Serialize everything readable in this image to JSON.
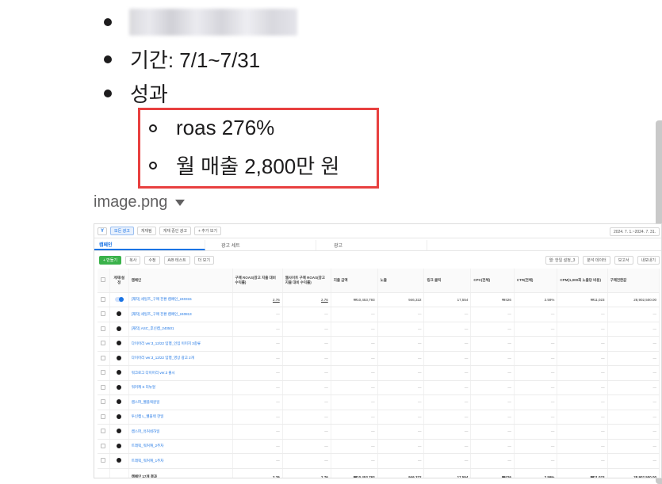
{
  "doc": {
    "bullets": [
      {
        "label": "기간: 7/1~7/31"
      },
      {
        "label": "성과"
      }
    ],
    "sub_bullets": [
      {
        "label": "roas 276%"
      },
      {
        "label": "월 매출 2,800만 원"
      }
    ],
    "attachment_name": "image.png"
  },
  "shot": {
    "toolbar": {
      "chips": [
        "모든 광고",
        "게재됨",
        "게재 중인 광고",
        "+ 추가 보기"
      ],
      "date_range": "2024. 7. 1.~2024. 7. 31."
    },
    "tabs": [
      "캠페인",
      "광고 세트",
      "광고"
    ],
    "actions": {
      "create": "+ 만들기",
      "duplicate": "복사",
      "edit": "수정",
      "ab_test": "A/B 테스트",
      "more": "더 보기",
      "columns": "열: 한일 설정_3",
      "breakdown": "분석 데이터",
      "reports": "보고서",
      "export": "내보내기"
    },
    "columns": [
      "게재/설정",
      "캠페인",
      "구매 ROAS(광고 지출 대비 수익률)",
      "웹사이트 구매 ROAS(광고 지출 대비 수익률)",
      "지출 금액",
      "노출",
      "링크 클릭",
      "CPC(전체)",
      "CTR(전체)",
      "CPM(1,000회 노출당 비용)",
      "구매전환값"
    ],
    "rows": [
      {
        "name": "[재작] 세일즈_구매 전환 캠페인_240315",
        "roas": "2.76",
        "web_roas": "2.76",
        "spend": "₩10,453,793",
        "impr": "946,322",
        "clicks": "17,554",
        "cpc": "₩426",
        "ctr": "2.59%",
        "cpm": "₩11,023",
        "value": "28,902,500.00",
        "active": true
      },
      {
        "name": "[재작] 세일즈_구매 전환 캠페인_240813",
        "roas": "—",
        "web_roas": "—",
        "spend": "—",
        "impr": "—",
        "clicks": "—",
        "cpc": "—",
        "ctr": "—",
        "cpm": "—",
        "value": "—",
        "active": false
      },
      {
        "name": "[재작] ASC_후신캠_240501",
        "roas": "—",
        "web_roas": "—",
        "spend": "—",
        "impr": "—",
        "clicks": "—",
        "cpc": "—",
        "ctr": "—",
        "cpm": "—",
        "value": "—",
        "active": false
      },
      {
        "name": "다이어리 ver.3_12/22 입행_인입 이미지 3종류",
        "roas": "—",
        "web_roas": "—",
        "spend": "—",
        "impr": "—",
        "clicks": "—",
        "cpc": "—",
        "ctr": "—",
        "cpm": "—",
        "value": "—",
        "active": false
      },
      {
        "name": "다이어리 ver.3_12/22 입행_영상 광고 2개",
        "roas": "—",
        "web_roas": "—",
        "spend": "—",
        "impr": "—",
        "clicks": "—",
        "cpc": "—",
        "ctr": "—",
        "cpm": "—",
        "value": "—",
        "active": false
      },
      {
        "name": "워크로그 다이어리 ver.3 출시",
        "roas": "—",
        "web_roas": "—",
        "spend": "—",
        "impr": "—",
        "clicks": "—",
        "cpc": "—",
        "ctr": "—",
        "cpm": "—",
        "value": "—",
        "active": false
      },
      {
        "name": "워커캐 S 리뉴얼",
        "roas": "—",
        "web_roas": "—",
        "spend": "—",
        "impr": "—",
        "clicks": "—",
        "cpc": "—",
        "ctr": "—",
        "cpm": "—",
        "value": "—",
        "active": false
      },
      {
        "name": "캠스파_웰플랙원일",
        "roas": "—",
        "web_roas": "—",
        "spend": "—",
        "impr": "—",
        "clicks": "—",
        "cpc": "—",
        "ctr": "—",
        "cpm": "—",
        "value": "—",
        "active": false
      },
      {
        "name": "투신캠 L_웰플렉 한일",
        "roas": "—",
        "web_roas": "—",
        "spend": "—",
        "impr": "—",
        "clicks": "—",
        "cpc": "—",
        "ctr": "—",
        "cpm": "—",
        "value": "—",
        "active": false
      },
      {
        "name": "캠스파_유커네하일",
        "roas": "—",
        "web_roas": "—",
        "spend": "—",
        "impr": "—",
        "clicks": "—",
        "cpc": "—",
        "ctr": "—",
        "cpm": "—",
        "value": "—",
        "active": false
      },
      {
        "name": "트래픽_워커캐_2주차",
        "roas": "—",
        "web_roas": "—",
        "spend": "—",
        "impr": "—",
        "clicks": "—",
        "cpc": "—",
        "ctr": "—",
        "cpm": "—",
        "value": "—",
        "active": false
      },
      {
        "name": "트래픽_워커캐_1주차",
        "roas": "—",
        "web_roas": "—",
        "spend": "—",
        "impr": "—",
        "clicks": "—",
        "cpc": "—",
        "ctr": "—",
        "cpm": "—",
        "value": "—",
        "active": false
      }
    ],
    "total": {
      "name": "캠페인 17개 결과",
      "roas": "2.76",
      "web_roas": "2.76",
      "spend": "₩10,453,793",
      "impr": "946,322",
      "clicks": "17,554",
      "cpc": "₩426",
      "ctr": "2.59%",
      "cpm": "₩11,023",
      "value": "28,902,500.00"
    }
  }
}
